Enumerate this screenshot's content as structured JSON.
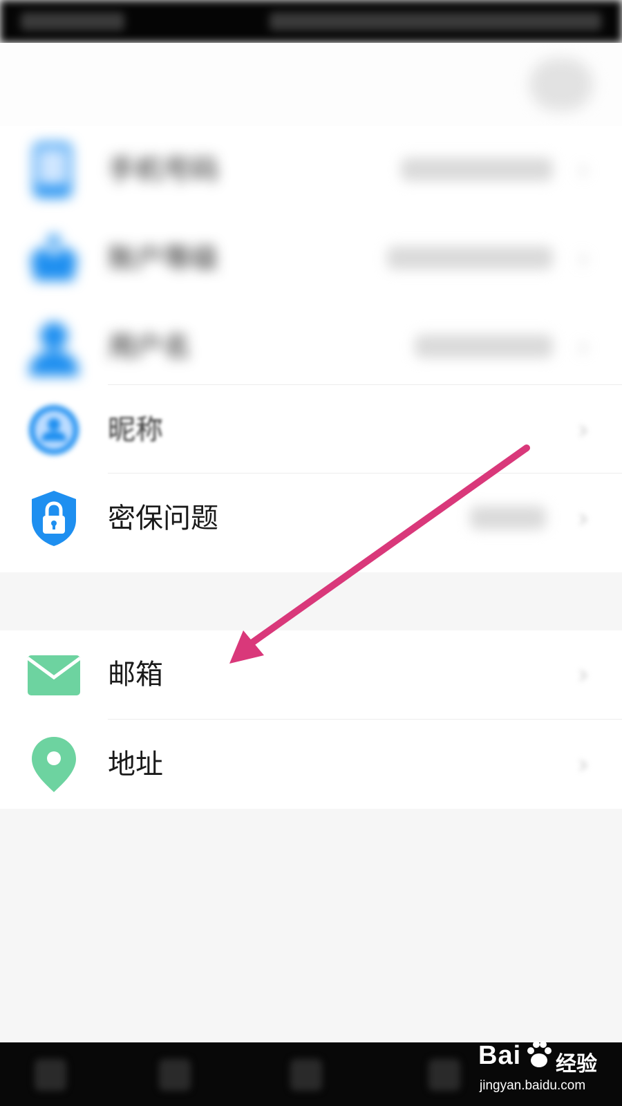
{
  "menu": {
    "items": [
      {
        "label": "手机号码",
        "icon": "phone-icon",
        "blurred": true
      },
      {
        "label": "账户等级",
        "icon": "crown-icon",
        "blurred": true
      },
      {
        "label": "用户名",
        "icon": "user-icon",
        "blurred": true
      },
      {
        "label": "昵称",
        "icon": "profile-circle-icon",
        "blurred": "partial"
      },
      {
        "label": "密保问题",
        "icon": "shield-lock-icon",
        "blurred": false
      },
      {
        "label": "邮箱",
        "icon": "mail-icon",
        "blurred": false
      },
      {
        "label": "地址",
        "icon": "location-pin-icon",
        "blurred": false
      }
    ],
    "chevron": "›"
  },
  "annotation": {
    "arrow_color": "#d9387a",
    "points_to": "邮箱"
  },
  "watermark": {
    "brand": "Bai",
    "cn": "经验",
    "url": "jingyan.baidu.com"
  },
  "colors": {
    "blue_icon": "#1e8ff0",
    "green_icon": "#6dd3a0",
    "background": "#f6f6f6"
  }
}
